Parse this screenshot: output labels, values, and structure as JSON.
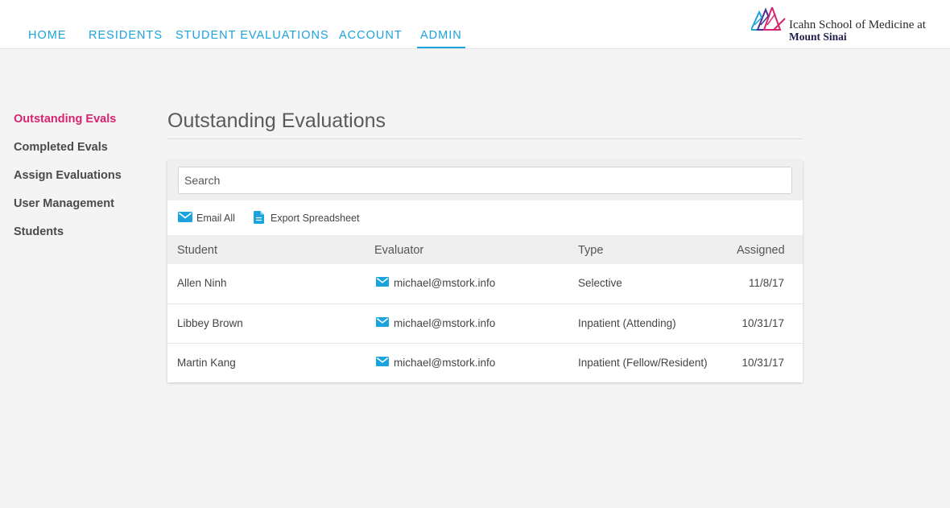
{
  "nav": {
    "items": [
      {
        "label": "HOME"
      },
      {
        "label": "RESIDENTS"
      },
      {
        "label": "STUDENT EVALUATIONS"
      },
      {
        "label": "ACCOUNT"
      },
      {
        "label": "ADMIN",
        "active": true
      }
    ]
  },
  "logo": {
    "line1": "Icahn School of Medicine at",
    "line2": "Mount Sinai"
  },
  "sidebar": {
    "items": [
      {
        "label": "Outstanding Evals",
        "active": true
      },
      {
        "label": "Completed Evals"
      },
      {
        "label": "Assign Evaluations"
      },
      {
        "label": "User Management"
      },
      {
        "label": "Students"
      }
    ]
  },
  "main": {
    "title": "Outstanding Evaluations",
    "search_placeholder": "Search",
    "actions": {
      "email_all": "Email All",
      "export": "Export Spreadsheet"
    },
    "table": {
      "headers": [
        "Student",
        "Evaluator",
        "Type",
        "Assigned"
      ],
      "rows": [
        [
          "Allen Ninh",
          "michael@mstork.info",
          "Selective",
          "11/8/17"
        ],
        [
          "Libbey Brown",
          "michael@mstork.info",
          "Inpatient (Attending)",
          "10/31/17"
        ],
        [
          "Martin Kang",
          "michael@mstork.info",
          "Inpatient (Fellow/Resident)",
          "10/31/17"
        ]
      ]
    }
  },
  "colors": {
    "accent": "#1ba3dd",
    "active_sidebar": "#d6246e",
    "background": "#f4f4f4"
  },
  "icons": {
    "mail": "mail-icon",
    "document": "document-icon",
    "logo": "mount-sinai-logo-icon"
  }
}
